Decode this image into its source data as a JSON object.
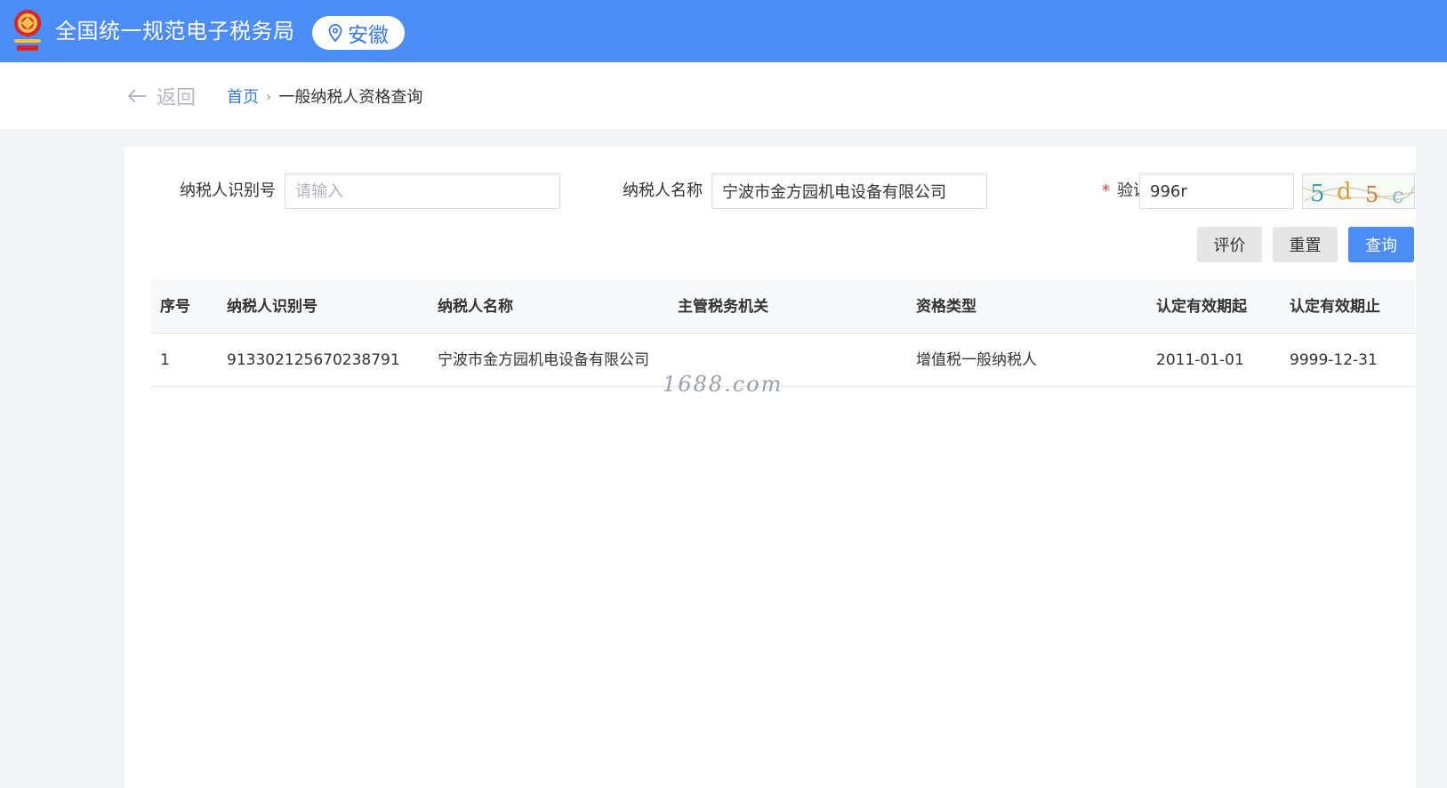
{
  "header": {
    "title": "全国统一规范电子税务局",
    "region": "安徽",
    "bg_color": "#4c8cf5",
    "emblem_icon": "tax-emblem-icon",
    "location_icon": "location-pin-icon"
  },
  "nav": {
    "back_label": "返回",
    "breadcrumb": {
      "home": "首页",
      "separator": "›",
      "current": "一般纳税人资格查询"
    }
  },
  "form": {
    "taxpayer_id": {
      "label": "纳税人识别号",
      "value": "",
      "placeholder": "请输入"
    },
    "taxpayer_name": {
      "label": "纳税人名称",
      "value": "宁波市金方园机电设备有限公司",
      "placeholder": ""
    },
    "captcha": {
      "required_mark": "*",
      "label": "验证码",
      "value": "996r",
      "image_text": "5d5c"
    }
  },
  "buttons": {
    "evaluate": "评价",
    "reset": "重置",
    "query": "查询"
  },
  "table": {
    "columns": [
      "序号",
      "纳税人识别号",
      "纳税人名称",
      "主管税务机关",
      "资格类型",
      "认定有效期起",
      "认定有效期止"
    ],
    "rows": [
      [
        "1",
        "913302125670238791",
        "宁波市金方园机电设备有限公司",
        "",
        "增值税一般纳税人",
        "2011-01-01",
        "9999-12-31"
      ]
    ]
  },
  "watermark": "1688.com"
}
